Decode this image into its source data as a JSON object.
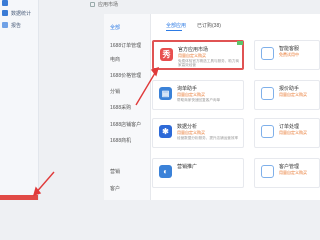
{
  "sidebar": {
    "items": [
      {
        "label": ""
      },
      {
        "label": "数据统计"
      },
      {
        "label": "报告"
      }
    ]
  },
  "header": {
    "title": "应用市场"
  },
  "categories": [
    {
      "label": "全部",
      "active": true
    },
    {
      "label": "1688订单管理"
    },
    {
      "label": "电商"
    },
    {
      "label": "1688价格管理"
    },
    {
      "label": "分销"
    },
    {
      "label": "1688采购"
    },
    {
      "label": "1688店铺客户"
    },
    {
      "label": "1688商机"
    },
    {
      "label": "营销"
    },
    {
      "label": "客户"
    }
  ],
  "tabs": [
    {
      "label": "全部应用",
      "active": true
    },
    {
      "label": "已订购(38)"
    }
  ],
  "apps": [
    {
      "name": "官方应用市场",
      "badge": "用量自定义购买",
      "desc": "免费体验官方精选工具与服务，助力商家高效经营",
      "icon": "秀",
      "color": "#e84f4f",
      "highlight": true
    },
    {
      "name": "智能客服",
      "badge": "免费试用中",
      "desc": "提供智能客服与自动回复服务",
      "icon": "",
      "color": "#3b82d8"
    },
    {
      "name": "询单助手",
      "badge": "用量自定义购买",
      "desc": "帮助商家快速回复客户询单",
      "icon": "",
      "color": "#2d6ad8"
    },
    {
      "name": "报价助手",
      "badge": "用量自定义购买",
      "desc": "一键生成报价单",
      "icon": "",
      "color": "#3b82d8"
    },
    {
      "name": "数据分析",
      "badge": "用量自定义购买",
      "desc": "经营数据分析服务，提升店铺运营效率",
      "icon": "",
      "color": "#2d6ad8"
    },
    {
      "name": "订单处理",
      "badge": "用量自定义购买",
      "desc": "订单批量处理工具",
      "icon": "",
      "color": "#3b82d8"
    },
    {
      "name": "营销推广",
      "badge": "",
      "desc": "",
      "icon": "",
      "color": "#3b82d8"
    },
    {
      "name": "客户管理",
      "badge": "用量自定义购买",
      "desc": "",
      "icon": "",
      "color": "#3b82d8"
    }
  ]
}
